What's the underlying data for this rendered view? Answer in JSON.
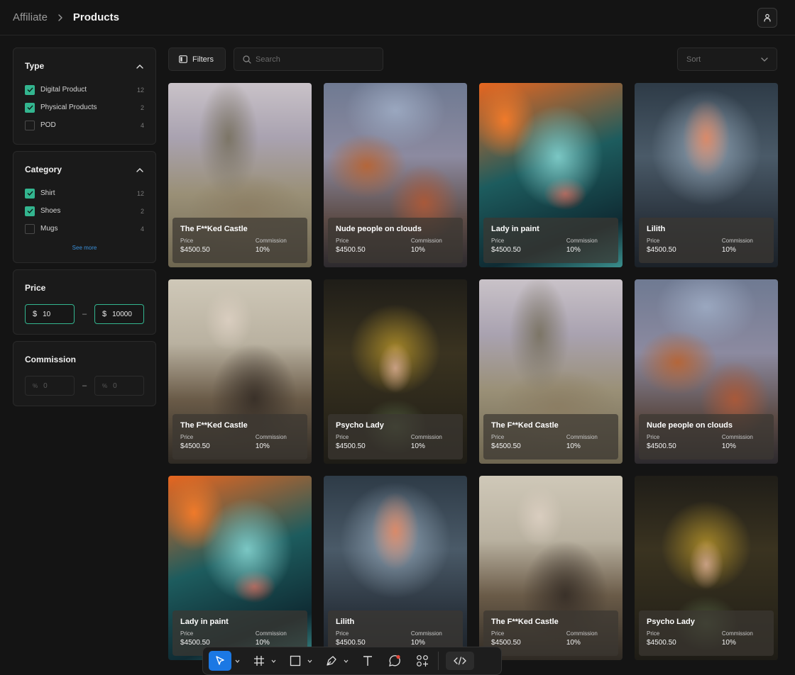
{
  "breadcrumb": {
    "parent": "Affiliate",
    "current": "Products"
  },
  "icons": {
    "separator": "chevron-right-icon",
    "user": "user-icon",
    "filters": "sidebar-panel-icon",
    "search": "search-icon",
    "sort": "chevron-down-icon"
  },
  "colors": {
    "accent": "#33b58f",
    "link": "#3a8fd8",
    "dock_selected": "#1b78e4",
    "background": "#141414"
  },
  "filters": {
    "type": {
      "title": "Type",
      "options": [
        {
          "label": "Digital Product",
          "count": "12",
          "checked": true
        },
        {
          "label": "Physical Products",
          "count": "2",
          "checked": true
        },
        {
          "label": "POD",
          "count": "4",
          "checked": false
        }
      ]
    },
    "category": {
      "title": "Category",
      "options": [
        {
          "label": "Shirt",
          "count": "12",
          "checked": true
        },
        {
          "label": "Shoes",
          "count": "2",
          "checked": true
        },
        {
          "label": "Mugs",
          "count": "4",
          "checked": false
        }
      ],
      "see_more": "See more"
    },
    "price": {
      "title": "Price",
      "prefix": "$",
      "min": "10",
      "max": "10000"
    },
    "commission": {
      "title": "Commission",
      "prefix": "%",
      "min_placeholder": "0",
      "max_placeholder": "0"
    }
  },
  "toolbar": {
    "filters_label": "Filters",
    "search_placeholder": "Search",
    "sort_label": "Sort"
  },
  "products": [
    {
      "title": "The F**Ked Castle",
      "price_label": "Price",
      "price": "$4500.50",
      "commission_label": "Commission",
      "commission": "10%",
      "art": "castle"
    },
    {
      "title": "Nude people on clouds",
      "price_label": "Price",
      "price": "$4500.50",
      "commission_label": "Commission",
      "commission": "10%",
      "art": "clouds"
    },
    {
      "title": "Lady in paint",
      "price_label": "Price",
      "price": "$4500.50",
      "commission_label": "Commission",
      "commission": "10%",
      "art": "paint"
    },
    {
      "title": "Lilith",
      "price_label": "Price",
      "price": "$4500.50",
      "commission_label": "Commission",
      "commission": "10%",
      "art": "lilith"
    },
    {
      "title": "The F**Ked Castle",
      "price_label": "Price",
      "price": "$4500.50",
      "commission_label": "Commission",
      "commission": "10%",
      "art": "warrior"
    },
    {
      "title": "Psycho Lady",
      "price_label": "Price",
      "price": "$4500.50",
      "commission_label": "Commission",
      "commission": "10%",
      "art": "psycho"
    },
    {
      "title": "The F**Ked Castle",
      "price_label": "Price",
      "price": "$4500.50",
      "commission_label": "Commission",
      "commission": "10%",
      "art": "castle"
    },
    {
      "title": "Nude people on clouds",
      "price_label": "Price",
      "price": "$4500.50",
      "commission_label": "Commission",
      "commission": "10%",
      "art": "clouds"
    },
    {
      "title": "Lady in paint",
      "price_label": "Price",
      "price": "$4500.50",
      "commission_label": "Commission",
      "commission": "10%",
      "art": "paint"
    },
    {
      "title": "Lilith",
      "price_label": "Price",
      "price": "$4500.50",
      "commission_label": "Commission",
      "commission": "10%",
      "art": "lilith"
    },
    {
      "title": "The F**Ked Castle",
      "price_label": "Price",
      "price": "$4500.50",
      "commission_label": "Commission",
      "commission": "10%",
      "art": "warrior"
    },
    {
      "title": "Psycho Lady",
      "price_label": "Price",
      "price": "$4500.50",
      "commission_label": "Commission",
      "commission": "10%",
      "art": "psycho"
    }
  ],
  "dock": {
    "tools": [
      {
        "name": "move-tool",
        "icon": "cursor-arrow-icon",
        "selected": true,
        "dropdown": true
      },
      {
        "name": "frame-tool",
        "icon": "frame-hash-icon",
        "selected": false,
        "dropdown": true
      },
      {
        "name": "rectangle-tool",
        "icon": "square-icon",
        "selected": false,
        "dropdown": true
      },
      {
        "name": "pen-tool",
        "icon": "pen-nib-icon",
        "selected": false,
        "dropdown": true
      },
      {
        "name": "text-tool",
        "icon": "text-t-icon",
        "selected": false,
        "dropdown": false
      },
      {
        "name": "comment-tool",
        "icon": "comment-bubble-icon",
        "selected": false,
        "dropdown": false
      },
      {
        "name": "components-tool",
        "icon": "components-icon",
        "selected": false,
        "dropdown": false
      }
    ],
    "dev_mode_icon": "code-brackets-icon"
  }
}
